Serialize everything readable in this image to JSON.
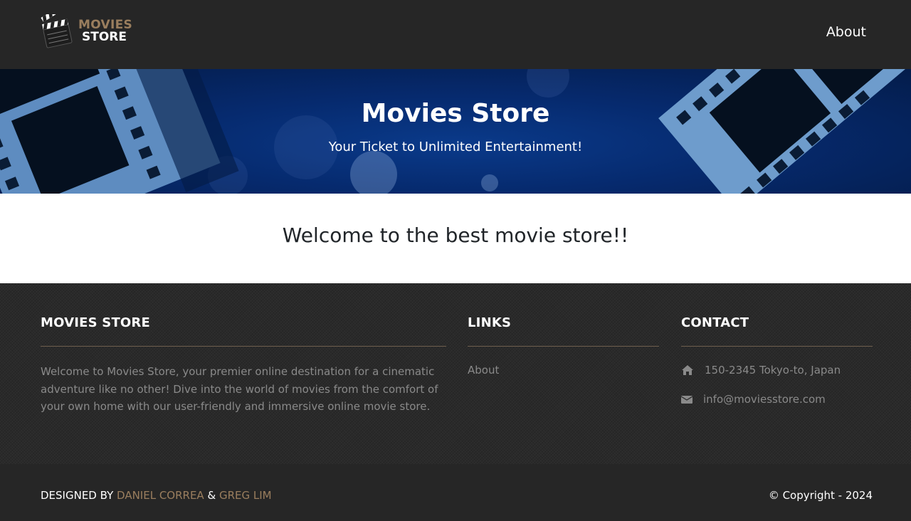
{
  "navbar": {
    "logo": {
      "line1": "MOVIES",
      "line2": "STORE"
    },
    "links": [
      {
        "label": "About"
      }
    ]
  },
  "hero": {
    "title": "Movies Store",
    "subtitle": "Your Ticket to Unlimited Entertainment!"
  },
  "main": {
    "heading": "Welcome to the best movie store!!"
  },
  "footer": {
    "about": {
      "title": "MOVIES STORE",
      "text": "Welcome to Movies Store, your premier online destination for a cinematic adventure like no other! Dive into the world of movies from the comfort of your own home with our user-friendly and immersive online movie store."
    },
    "links": {
      "title": "LINKS",
      "items": [
        {
          "label": "About"
        }
      ]
    },
    "contact": {
      "title": "CONTACT",
      "address": "150-2345 Tokyo-to, Japan",
      "email": "info@moviesstore.com",
      "address_icon": "home-icon",
      "email_icon": "envelope-icon"
    }
  },
  "bottom": {
    "designed_by": "DESIGNED BY",
    "author1": "DANIEL CORREA",
    "separator": "&",
    "author2": "GREG LIM",
    "copyright": "© Copyright - 2024"
  },
  "colors": {
    "navbar_bg": "#262626",
    "hero_bg": "#062a6e",
    "accent": "#9a7e5e",
    "footer_text": "#8a8a8a"
  }
}
